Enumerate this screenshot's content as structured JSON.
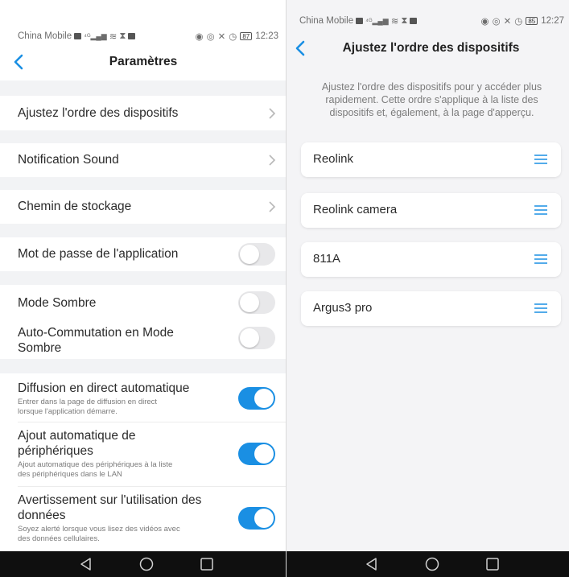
{
  "left_screen": {
    "status_bar": {
      "carrier": "China Mobile",
      "time": "12:23",
      "battery": "87"
    },
    "header": {
      "title": "Paramètres"
    },
    "settings": {
      "device_order": "Ajustez l'ordre des dispositifs",
      "notification_sound": "Notification Sound",
      "storage_path": "Chemin de stockage",
      "app_password": "Mot de passe de l'application",
      "dark_mode": "Mode Sombre",
      "auto_dark_mode_line1": "Auto-Commutation en Mode",
      "auto_dark_mode_line2": "Sombre",
      "auto_live_title": "Diffusion en direct automatique",
      "auto_live_desc1": "Entrer dans la page de diffusion en direct",
      "auto_live_desc2": "lorsque l'application démarre.",
      "auto_add_title1": "Ajout automatique de",
      "auto_add_title2": "périphériques",
      "auto_add_desc1": "Ajout automatique des périphériques à la liste",
      "auto_add_desc2": "des périphériques dans le LAN",
      "data_warning_title1": "Avertissement sur l'utilisation des",
      "data_warning_title2": "données",
      "data_warning_desc1": "Soyez alerté lorsque vous lisez des vidéos avec",
      "data_warning_desc2": "des données cellulaires."
    },
    "toggle_states": {
      "app_password": false,
      "dark_mode": false,
      "auto_dark_mode": false,
      "auto_live": true,
      "auto_add": true,
      "data_warning": true
    }
  },
  "right_screen": {
    "status_bar": {
      "carrier": "China Mobile",
      "time": "12:27",
      "battery": "85"
    },
    "header": {
      "title": "Ajustez l'ordre des dispositifs"
    },
    "description_lines": [
      "Ajustez l'ordre des dispositifs pour y accéder plus",
      "rapidement. Cette ordre s'applique à la liste des",
      "dispositifs et, également, à la page d'apperçu."
    ],
    "devices": [
      "Reolink",
      "Reolink camera",
      "811A",
      "Argus3 pro"
    ]
  },
  "icons": {
    "back": "chevron-left-icon",
    "chevron": "chevron-right-icon",
    "handle": "drag-handle-icon",
    "nav_back": "triangle-back-icon",
    "nav_home": "circle-home-icon",
    "nav_recent": "square-recent-icon"
  },
  "colors": {
    "accent": "#1a8fe3",
    "toggle_off": "#e8e8ea",
    "page_bg": "#f2f3f5",
    "nav_bg": "#0f0f0f"
  }
}
